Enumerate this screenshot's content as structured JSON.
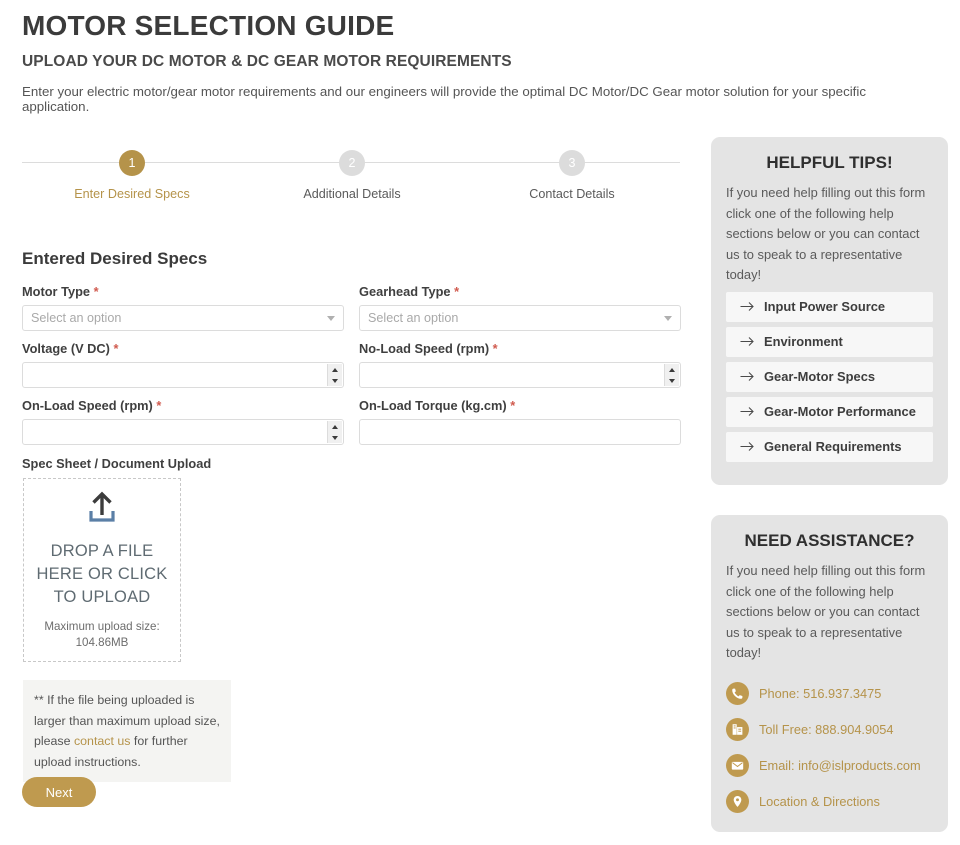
{
  "header": {
    "title": "MOTOR SELECTION GUIDE",
    "subtitle": "UPLOAD YOUR DC MOTOR & DC GEAR MOTOR REQUIREMENTS",
    "intro": "Enter your electric motor/gear motor requirements and our engineers will provide the optimal DC Motor/DC Gear motor solution for your specific application."
  },
  "stepper": {
    "steps": [
      {
        "number": "1",
        "label": "Enter Desired Specs",
        "active": true
      },
      {
        "number": "2",
        "label": "Additional Details",
        "active": false
      },
      {
        "number": "3",
        "label": "Contact Details",
        "active": false
      }
    ]
  },
  "form": {
    "title": "Entered Desired Specs",
    "required_marker": "*",
    "fields": [
      {
        "label": "Motor Type",
        "type": "select",
        "placeholder": "Select an option",
        "value": "",
        "required": true
      },
      {
        "label": "Gearhead Type",
        "type": "select",
        "placeholder": "Select an option",
        "value": "",
        "required": true
      },
      {
        "label": "Voltage (V DC)",
        "type": "number",
        "placeholder": "",
        "value": "",
        "required": true
      },
      {
        "label": "No-Load Speed (rpm)",
        "type": "number",
        "placeholder": "",
        "value": "",
        "required": true
      },
      {
        "label": "On-Load Speed (rpm)",
        "type": "number",
        "placeholder": "",
        "value": "",
        "required": true
      },
      {
        "label": "On-Load Torque (kg.cm)",
        "type": "text",
        "placeholder": "",
        "value": "",
        "required": true
      }
    ]
  },
  "upload": {
    "title": "Spec Sheet / Document Upload",
    "dropzone_text": "DROP A FILE HERE OR CLICK TO UPLOAD",
    "max_size_label": "Maximum upload size:",
    "max_size_value": "104.86MB",
    "icon": "upload-icon",
    "note_before": "** If the file being uploaded is larger than maximum upload size, please ",
    "note_link": "contact us",
    "note_after": " for further upload instructions."
  },
  "actions": {
    "next_label": "Next"
  },
  "tips_panel": {
    "title": "HELPFUL TIPS!",
    "body": "If you need help filling out this form click one of the following help sections below or you can contact us to speak to a representative today!",
    "items": [
      {
        "label": "Input Power Source",
        "icon": "arrow-right-icon"
      },
      {
        "label": "Environment",
        "icon": "arrow-right-icon"
      },
      {
        "label": "Gear-Motor Specs",
        "icon": "arrow-right-icon"
      },
      {
        "label": "Gear-Motor Performance",
        "icon": "arrow-right-icon"
      },
      {
        "label": "General Requirements",
        "icon": "arrow-right-icon"
      }
    ]
  },
  "assistance_panel": {
    "title": "NEED ASSISTANCE?",
    "body": "If you need help filling out this form click one of the following help sections below or you can contact us to speak to a representative today!",
    "contacts": [
      {
        "label": "Phone: 516.937.3475",
        "icon": "phone-icon"
      },
      {
        "label": "Toll Free: 888.904.9054",
        "icon": "fax-icon"
      },
      {
        "label": "Email: info@islproducts.com",
        "icon": "envelope-icon"
      },
      {
        "label": "Location & Directions",
        "icon": "location-pin-icon"
      }
    ]
  },
  "colors": {
    "accent_gold": "#b5934a",
    "button_gold": "#bf9a4f",
    "panel_grey": "#e4e4e4",
    "required_red": "#d05a4e"
  }
}
